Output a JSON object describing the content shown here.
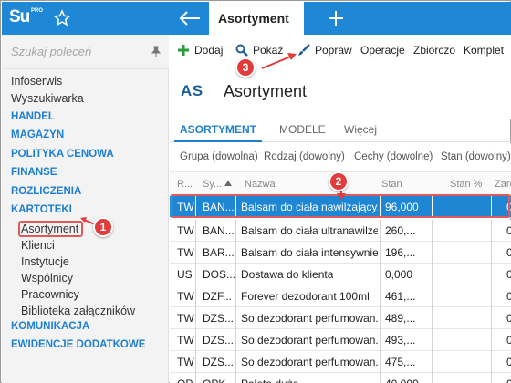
{
  "app": {
    "logo_main": "Su",
    "logo_sup": "PRO",
    "active_tab": "Asortyment"
  },
  "sidebar": {
    "search_placeholder": "Szukaj poleceń",
    "items": [
      {
        "label": "Infoserwis",
        "type": "item"
      },
      {
        "label": "Wyszukiwarka",
        "type": "item"
      },
      {
        "label": "HANDEL",
        "type": "section"
      },
      {
        "label": "MAGAZYN",
        "type": "section"
      },
      {
        "label": "POLITYKA CENOWA",
        "type": "section"
      },
      {
        "label": "FINANSE",
        "type": "section"
      },
      {
        "label": "ROZLICZENIA",
        "type": "section"
      },
      {
        "label": "KARTOTEKI",
        "type": "section"
      },
      {
        "label": "Asortyment",
        "type": "sub",
        "selected": true
      },
      {
        "label": "Klienci",
        "type": "sub"
      },
      {
        "label": "Instytucje",
        "type": "sub"
      },
      {
        "label": "Wspólnicy",
        "type": "sub"
      },
      {
        "label": "Pracownicy",
        "type": "sub"
      },
      {
        "label": "Biblioteka załączników",
        "type": "sub"
      },
      {
        "label": "KOMUNIKACJA",
        "type": "section"
      },
      {
        "label": "EWIDENCJE DODATKOWE",
        "type": "section"
      }
    ]
  },
  "toolbar": {
    "add": "Dodaj",
    "show": "Pokaż",
    "edit": "Popraw",
    "operations": "Operacje",
    "collective": "Zbiorczo",
    "set": "Komplet"
  },
  "header": {
    "abbr": "AS",
    "title": "Asortyment"
  },
  "tabs": [
    "ASORTYMENT",
    "MODELE",
    "Więcej"
  ],
  "filters": [
    "Grupa (dowolna)",
    "Rodzaj (dowolny)",
    "Cechy (dowolne)",
    "Stan (dowolny)"
  ],
  "grid": {
    "columns": [
      "R...",
      "Sy...",
      "Nazwa",
      "Stan",
      "Stan %",
      "Zare"
    ],
    "rows": [
      {
        "r": "TW",
        "sym": "BAN...",
        "name": "Balsam do ciała nawilżający...",
        "stan": "96,000",
        "pct": "",
        "z": "0",
        "selected": true
      },
      {
        "r": "TW",
        "sym": "BAN...",
        "name": "Balsam do ciała ultranawilże...",
        "stan": "260,...",
        "pct": "",
        "z": "0"
      },
      {
        "r": "TW",
        "sym": "BAR...",
        "name": "Balsam do ciała intensywnie...",
        "stan": "196,...",
        "pct": "",
        "z": "0"
      },
      {
        "r": "US",
        "sym": "DOS...",
        "name": "Dostawa do klienta",
        "stan": "0,000",
        "pct": "",
        "z": "0"
      },
      {
        "r": "TW",
        "sym": "DZF...",
        "name": "Forever dezodorant 100ml",
        "stan": "461,...",
        "pct": "",
        "z": "0"
      },
      {
        "r": "TW",
        "sym": "DZS...",
        "name": "So dezodorant perfumowan...",
        "stan": "489,...",
        "pct": "",
        "z": "0"
      },
      {
        "r": "TW",
        "sym": "DZS...",
        "name": "So dezodorant perfumowan...",
        "stan": "493,...",
        "pct": "",
        "z": "0"
      },
      {
        "r": "TW",
        "sym": "DZS...",
        "name": "So dezodorant perfumowan...",
        "stan": "475,...",
        "pct": "",
        "z": "0"
      },
      {
        "r": "OP",
        "sym": "OPK...",
        "name": "Paleta duża",
        "stan": "40,000",
        "pct": "",
        "z": "0"
      }
    ]
  },
  "badges": [
    "1",
    "2",
    "3"
  ],
  "colors": {
    "brand": "#1e88d6",
    "section": "#1e7fd0",
    "selection": "#1f86d3",
    "callout": "#e23b3b",
    "add_icon": "#2e9b3a"
  }
}
